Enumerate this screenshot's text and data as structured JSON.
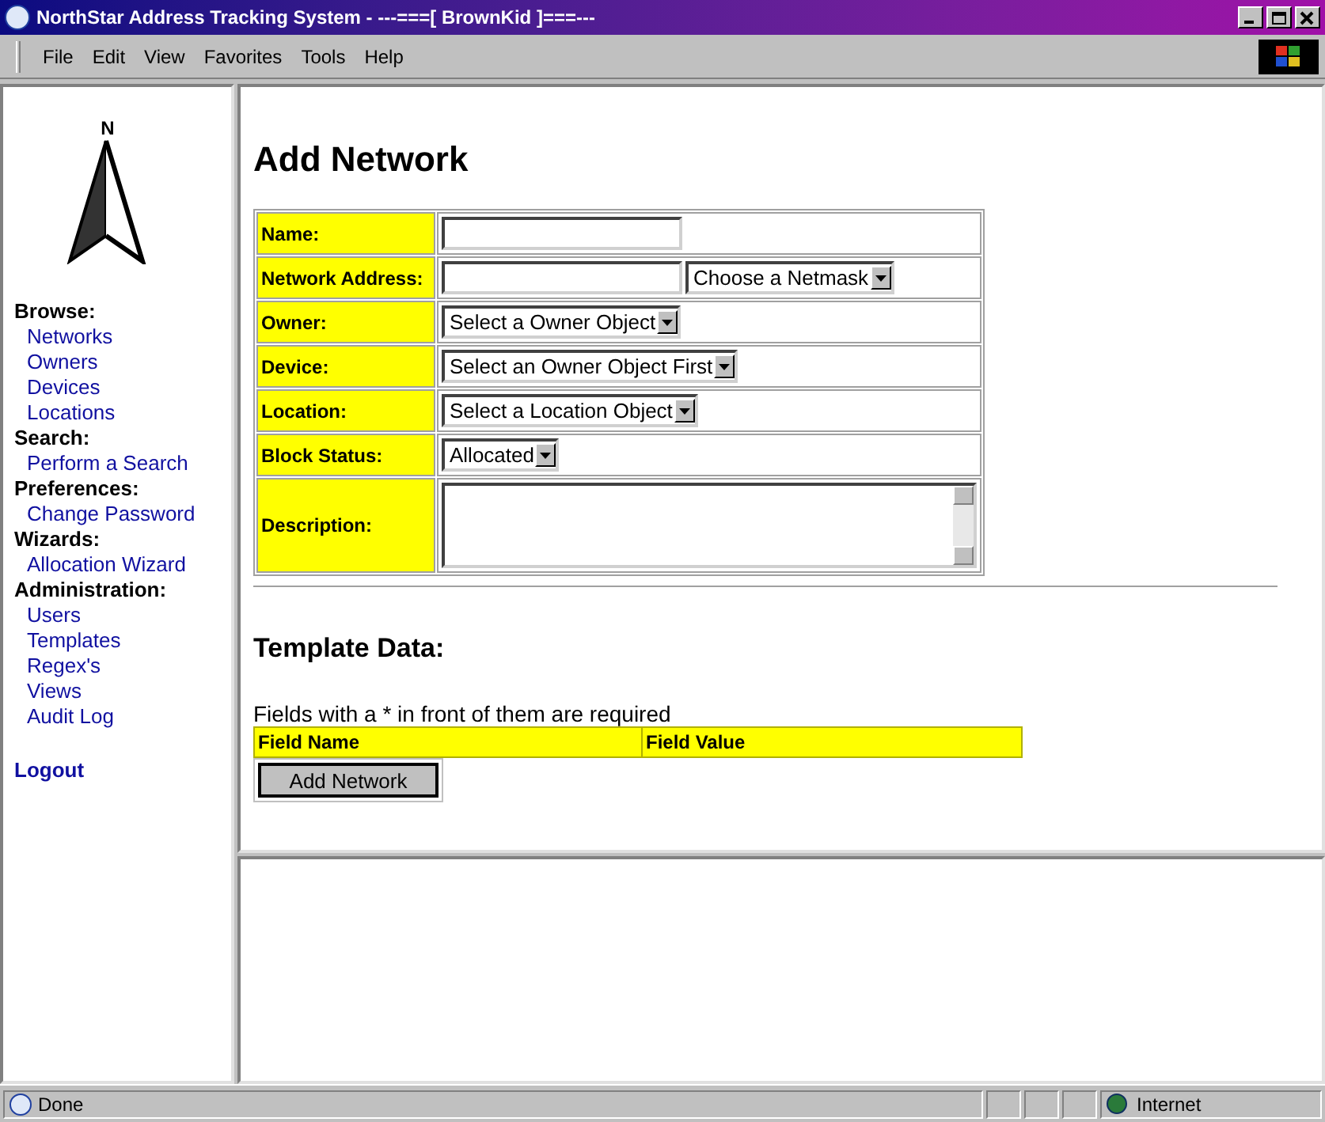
{
  "window": {
    "title": "NorthStar Address Tracking System - ---===[ BrownKid ]===---"
  },
  "menu": [
    "File",
    "Edit",
    "View",
    "Favorites",
    "Tools",
    "Help"
  ],
  "sidebar": {
    "logo_letter": "N",
    "sections": [
      {
        "heading": "Browse:",
        "links": [
          "Networks",
          "Owners",
          "Devices",
          "Locations"
        ]
      },
      {
        "heading": "Search:",
        "links": [
          "Perform a Search"
        ]
      },
      {
        "heading": "Preferences:",
        "links": [
          "Change Password"
        ]
      },
      {
        "heading": "Wizards:",
        "links": [
          "Allocation Wizard"
        ]
      },
      {
        "heading": "Administration:",
        "links": [
          "Users",
          "Templates",
          "Regex's",
          "Views",
          "Audit Log"
        ]
      }
    ],
    "logout": "Logout"
  },
  "page": {
    "title": "Add Network",
    "form": [
      {
        "label": "Name:",
        "controls": [
          {
            "kind": "text"
          }
        ]
      },
      {
        "label": "Network Address:",
        "controls": [
          {
            "kind": "text"
          },
          {
            "kind": "select",
            "value": "Choose a Netmask"
          }
        ]
      },
      {
        "label": "Owner:",
        "controls": [
          {
            "kind": "select",
            "value": "Select a Owner Object"
          }
        ]
      },
      {
        "label": "Device:",
        "controls": [
          {
            "kind": "select",
            "value": "Select an Owner Object First"
          }
        ]
      },
      {
        "label": "Location:",
        "controls": [
          {
            "kind": "select",
            "value": "Select a Location Object"
          }
        ]
      },
      {
        "label": "Block Status:",
        "controls": [
          {
            "kind": "select",
            "value": "Allocated"
          }
        ]
      },
      {
        "label": "Description:",
        "controls": [
          {
            "kind": "textarea"
          }
        ]
      }
    ],
    "template_heading": "Template Data:",
    "note": "Fields with a * in front of them are required",
    "template_columns": [
      "Field Name",
      "Field Value"
    ],
    "submit": "Add Network"
  },
  "status_bar": {
    "text": "Done",
    "zone": "Internet"
  }
}
